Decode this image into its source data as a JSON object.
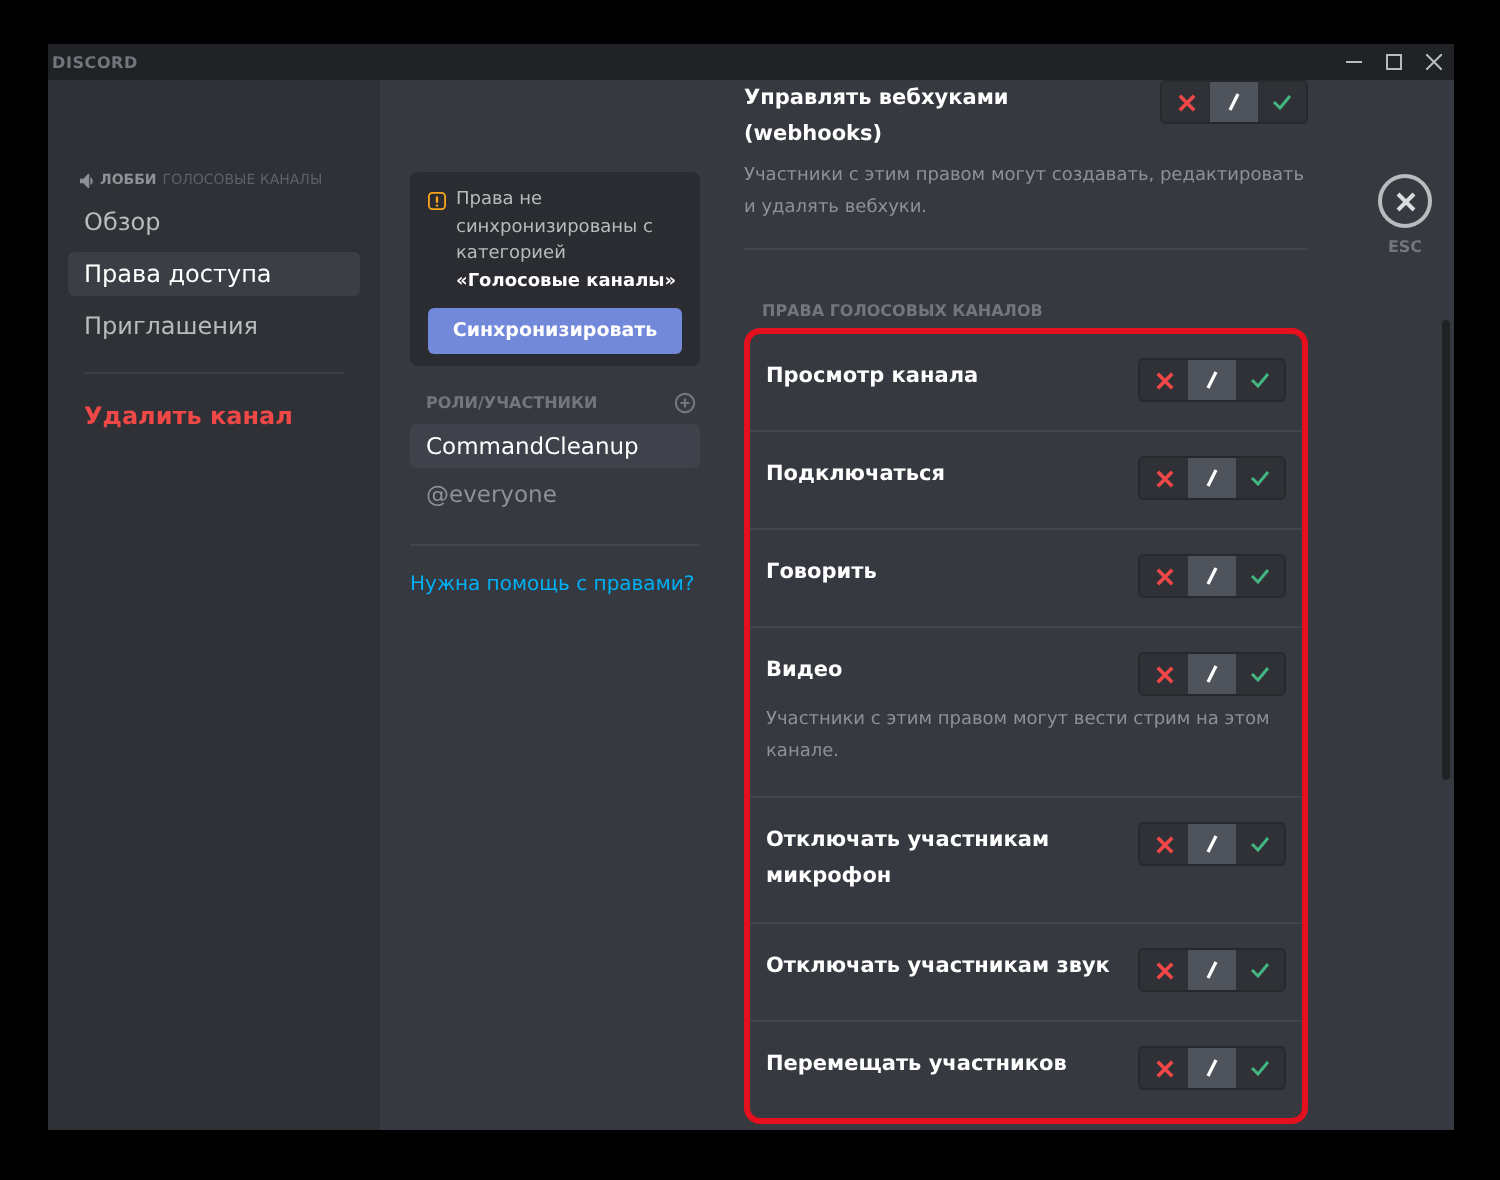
{
  "window": {
    "title": "DISCORD"
  },
  "sidebar": {
    "channel": "ЛОББИ",
    "category": "ГОЛОСОВЫЕ КАНАЛЫ",
    "items": [
      {
        "label": "Обзор",
        "selected": false,
        "kind": "nav"
      },
      {
        "label": "Права доступа",
        "selected": true,
        "kind": "nav"
      },
      {
        "label": "Приглашения",
        "selected": false,
        "kind": "nav"
      },
      {
        "label": "Удалить канал",
        "selected": false,
        "kind": "danger"
      }
    ]
  },
  "sync_notice": {
    "text": "Права не синхронизированы с категорией **«Голосовые каналы»**",
    "button": "Синхронизировать"
  },
  "roles": {
    "title": "РОЛИ/УЧАСТНИКИ",
    "items": [
      {
        "label": "CommandCleanup",
        "selected": true
      },
      {
        "label": "@everyone",
        "selected": false
      }
    ],
    "help_link": "Нужна помощь с правами?"
  },
  "general_permissions": [
    {
      "title": "Управлять вебхуками (webhooks)",
      "description": "Участники с этим правом могут создавать, редактировать и удалять вебхуки.",
      "denied": false,
      "allowed": false
    }
  ],
  "voice_permissions": {
    "title": "ПРАВА ГОЛОСОВЫХ КАНАЛОВ",
    "highlighted": true,
    "items": [
      {
        "title": "Просмотр канала",
        "denied": false,
        "allowed": false
      },
      {
        "title": "Подключаться",
        "denied": false,
        "allowed": false
      },
      {
        "title": "Говорить",
        "denied": false,
        "allowed": false
      },
      {
        "title": "Видео",
        "description": "Участники с этим правом могут вести стрим на этом канале.",
        "denied": false,
        "allowed": false
      },
      {
        "title": "Отключать участникам микрофон",
        "denied": false,
        "allowed": false
      },
      {
        "title": "Отключать участникам звук",
        "denied": false,
        "allowed": false
      },
      {
        "title": "Перемещать участников",
        "denied": false,
        "allowed": false
      }
    ]
  },
  "close": {
    "label": "ESC"
  }
}
